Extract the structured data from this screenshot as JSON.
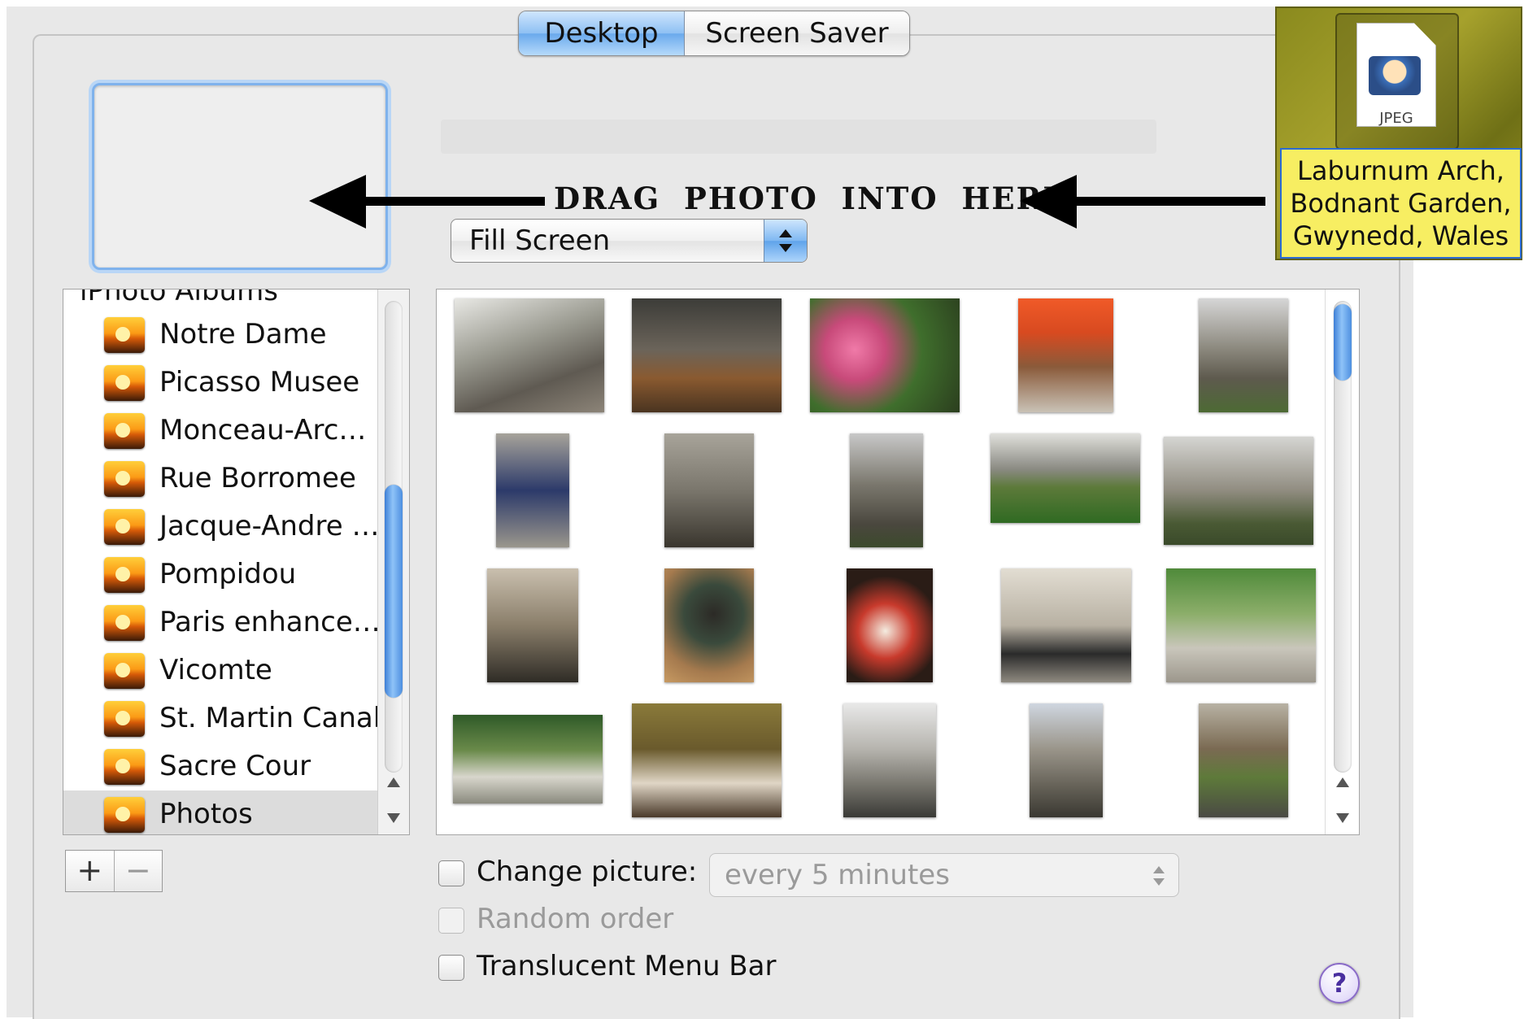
{
  "tabs": [
    {
      "label": "Desktop",
      "selected": true
    },
    {
      "label": "Screen Saver",
      "selected": false
    }
  ],
  "annotation": {
    "text": "DRAG  PHOTO  INTO  HERE"
  },
  "picture_options": {
    "selected": "Fill Screen"
  },
  "sidebar": {
    "header": "iPhoto Albums",
    "items": [
      {
        "label": "Notre Dame"
      },
      {
        "label": "Picasso Musee"
      },
      {
        "label": "Monceau-Arc…"
      },
      {
        "label": "Rue Borromee"
      },
      {
        "label": "Jacque-Andre …"
      },
      {
        "label": "Pompidou"
      },
      {
        "label": "Paris enhance…"
      },
      {
        "label": "Vicomte"
      },
      {
        "label": "St. Martin Canal"
      },
      {
        "label": "Sacre Cour"
      },
      {
        "label": "Photos",
        "selected": true
      }
    ]
  },
  "list_buttons": {
    "add": "+",
    "remove": "−"
  },
  "options": {
    "change_picture_label": "Change picture:",
    "change_picture_checked": false,
    "interval": "every 5 minutes",
    "random_order_label": "Random order",
    "random_order_enabled": false,
    "translucent_label": "Translucent Menu Bar",
    "translucent_checked": false
  },
  "help": {
    "label": "?"
  },
  "desktop_file": {
    "type_label": "JPEG",
    "name_lines": [
      "Laburnum Arch,",
      "Bodnant Garden,",
      "Gwynedd, Wales"
    ]
  },
  "colors": {
    "selection_blue": "#6aa9ec",
    "annotation_arrow": "#000000",
    "file_label_highlight": "#f7ee62"
  }
}
